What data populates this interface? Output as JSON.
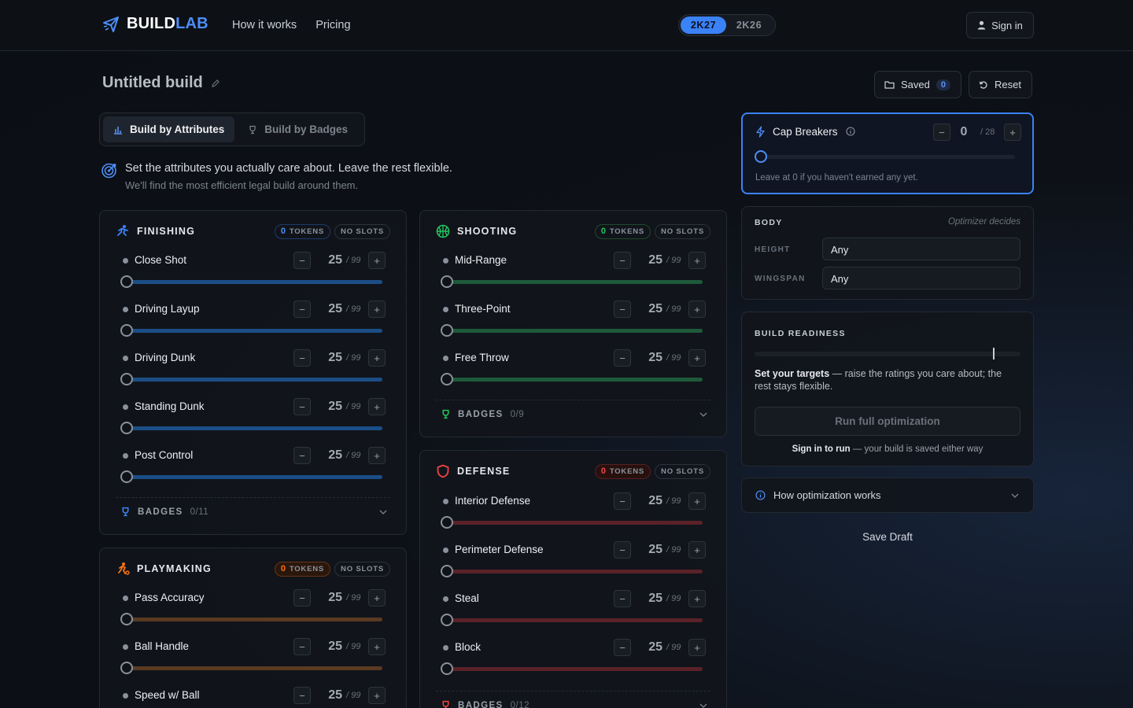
{
  "header": {
    "logo_build": "BUILD",
    "logo_lab": "LAB",
    "nav": [
      "How it works",
      "Pricing"
    ],
    "versions": [
      "2K27",
      "2K26"
    ],
    "active_version": "2K27",
    "signin_label": "Sign in"
  },
  "build": {
    "title": "Untitled build",
    "saved_label": "Saved",
    "saved_count": "0",
    "reset_label": "Reset"
  },
  "modes": {
    "attributes_label": "Build by Attributes",
    "badges_label": "Build by Badges",
    "active": "attributes"
  },
  "intro": {
    "line1": "Set the attributes you actually care about. Leave the rest flexible.",
    "line2": "We'll find the most efficient legal build around them."
  },
  "categories": {
    "finishing": {
      "title": "FINISHING",
      "tokens_num": "0",
      "tokens_label": "TOKENS",
      "slots_label": "NO SLOTS",
      "color": "#3b82f6",
      "attrs": [
        {
          "name": "Close Shot",
          "value": "25",
          "max": "/ 99"
        },
        {
          "name": "Driving Layup",
          "value": "25",
          "max": "/ 99"
        },
        {
          "name": "Driving Dunk",
          "value": "25",
          "max": "/ 99"
        },
        {
          "name": "Standing Dunk",
          "value": "25",
          "max": "/ 99"
        },
        {
          "name": "Post Control",
          "value": "25",
          "max": "/ 99"
        }
      ],
      "badges_label": "BADGES",
      "badges_count": "0/11"
    },
    "shooting": {
      "title": "SHOOTING",
      "tokens_num": "0",
      "tokens_label": "TOKENS",
      "slots_label": "NO SLOTS",
      "color": "#22c55e",
      "attrs": [
        {
          "name": "Mid-Range",
          "value": "25",
          "max": "/ 99"
        },
        {
          "name": "Three-Point",
          "value": "25",
          "max": "/ 99"
        },
        {
          "name": "Free Throw",
          "value": "25",
          "max": "/ 99"
        }
      ],
      "badges_label": "BADGES",
      "badges_count": "0/9"
    },
    "playmaking": {
      "title": "PLAYMAKING",
      "tokens_num": "0",
      "tokens_label": "TOKENS",
      "slots_label": "NO SLOTS",
      "color": "#f97316",
      "attrs": [
        {
          "name": "Pass Accuracy",
          "value": "25",
          "max": "/ 99"
        },
        {
          "name": "Ball Handle",
          "value": "25",
          "max": "/ 99"
        },
        {
          "name": "Speed w/ Ball",
          "value": "25",
          "max": "/ 99"
        }
      ]
    },
    "defense": {
      "title": "DEFENSE",
      "tokens_num": "0",
      "tokens_label": "TOKENS",
      "slots_label": "NO SLOTS",
      "color": "#ef4444",
      "attrs": [
        {
          "name": "Interior Defense",
          "value": "25",
          "max": "/ 99"
        },
        {
          "name": "Perimeter Defense",
          "value": "25",
          "max": "/ 99"
        },
        {
          "name": "Steal",
          "value": "25",
          "max": "/ 99"
        },
        {
          "name": "Block",
          "value": "25",
          "max": "/ 99"
        }
      ],
      "badges_label": "BADGES",
      "badges_count": "0/12"
    }
  },
  "cap_breakers": {
    "title": "Cap Breakers",
    "value": "0",
    "max": "/ 28",
    "hint": "Leave at 0 if you haven't earned any yet."
  },
  "body": {
    "title": "BODY",
    "note": "Optimizer decides",
    "height_label": "HEIGHT",
    "height_value": "Any",
    "wingspan_label": "WINGSPAN",
    "wingspan_value": "Any"
  },
  "readiness": {
    "title": "BUILD READINESS",
    "msg_bold": "Set your targets",
    "msg_rest": " — raise the ratings you care about; the rest stays flexible.",
    "run_label": "Run full optimization",
    "signin_bold": "Sign in to run",
    "signin_rest": " — your build is saved either way"
  },
  "how": {
    "label": "How optimization works"
  },
  "save_draft": "Save Draft"
}
